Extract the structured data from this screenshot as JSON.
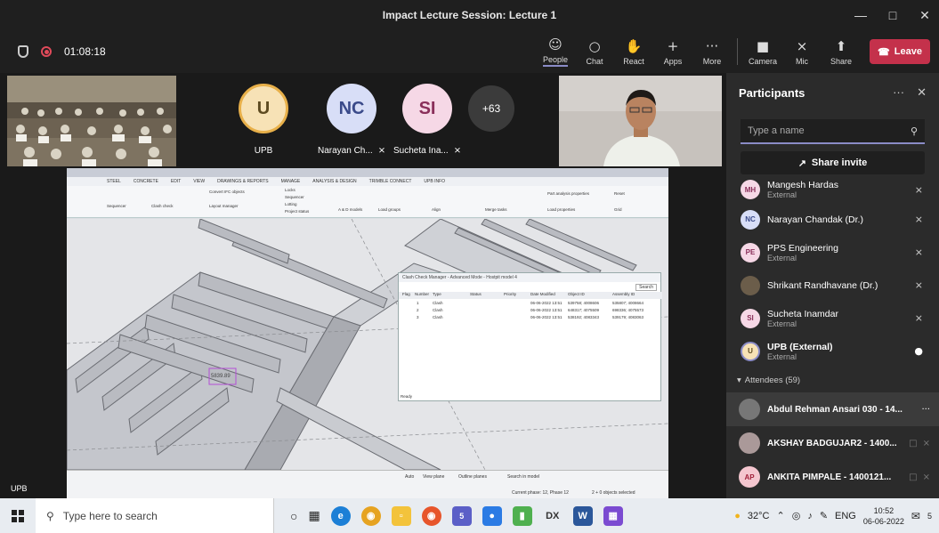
{
  "window": {
    "title": "Impact Lecture Session: Lecture 1"
  },
  "toolbar": {
    "timer": "01:08:18",
    "buttons": [
      {
        "label": "People",
        "icon": "people-icon"
      },
      {
        "label": "Chat",
        "icon": "chat-icon"
      },
      {
        "label": "React",
        "icon": "react-icon"
      },
      {
        "label": "Apps",
        "icon": "apps-icon"
      },
      {
        "label": "More",
        "icon": "more-icon"
      },
      {
        "label": "Camera",
        "icon": "camera-icon"
      },
      {
        "label": "Mic",
        "icon": "mic-off-icon"
      },
      {
        "label": "Share",
        "icon": "share-icon"
      }
    ],
    "leave_label": "Leave"
  },
  "stage": {
    "tiles": [
      {
        "initials": "U",
        "name": "UPB",
        "bg": "#f7e2b6",
        "fg": "#5d4a20"
      },
      {
        "initials": "NC",
        "name": "Narayan Ch...",
        "bg": "#d8def7",
        "fg": "#3a4a8a"
      },
      {
        "initials": "SI",
        "name": "Sucheta Ina...",
        "bg": "#f6d8e6",
        "fg": "#8a2f5a"
      }
    ],
    "overflow_count": "+63",
    "bottom_label": "UPB"
  },
  "shared_screen": {
    "tabs": [
      "STEEL",
      "CONCRETE",
      "EDIT",
      "VIEW",
      "DRAWINGS & REPORTS",
      "MANAGE",
      "ANALYSIS & DESIGN",
      "TRIMBLE CONNECT",
      "UPB INFO"
    ],
    "ribbon_items": [
      "Sequencer",
      "Clash check",
      "Convert IFC objects",
      "Layout manager",
      "Locks",
      "Sequencer",
      "Lotting",
      "Project status",
      "A & D models",
      "Load groups",
      "Align",
      "Merge tasks",
      "Part analysis properties",
      "Load properties",
      "Reset",
      "Grid"
    ],
    "dialog": {
      "title": "Clash Check Manager - Advanced Mode - Hostpit model 4",
      "search_btn": "Search",
      "columns": [
        "Flag",
        "Number",
        "Type",
        "Status",
        "Priority",
        "Date Modified",
        "Object ID",
        "Assembly ID"
      ],
      "rows": [
        [
          "1",
          "Clash",
          "06-06-2022 13:51",
          "539758; 4008606",
          "535807; 4008664"
        ],
        [
          "2",
          "Clash",
          "06-06-2022 13:51",
          "648317; 4075509",
          "698336; 4075573"
        ],
        [
          "3",
          "Clash",
          "06-06-2022 13:51",
          "538192; 4083343",
          "539179; 4083063"
        ]
      ],
      "status": "Ready"
    },
    "coords_label": "5839.89",
    "bottom_items": [
      "Auto",
      "View plane",
      "Outline planes",
      "Search in model",
      "Current phase: 12, Phase 12",
      "2 + 0 objects selected"
    ]
  },
  "panel": {
    "title": "Participants",
    "search_placeholder": "Type a name",
    "share_invite": "Share invite",
    "participants": [
      {
        "initials": "MH",
        "name": "Mangesh Hardas",
        "sub": "External",
        "bg": "#f6d8e6",
        "fg": "#8a2f5a",
        "icon": "mic-off-icon"
      },
      {
        "initials": "NC",
        "name": "Narayan Chandak (Dr.)",
        "sub": "",
        "bg": "#d8def7",
        "fg": "#3a4a8a",
        "icon": "mic-off-icon"
      },
      {
        "initials": "PE",
        "name": "PPS Engineering",
        "sub": "External",
        "bg": "#f6d8e6",
        "fg": "#8a2f5a",
        "icon": "mic-off-icon"
      },
      {
        "initials": "",
        "name": "Shrikant Randhavane (Dr.)",
        "sub": "",
        "bg": "#6b5d4a",
        "fg": "#fff",
        "icon": "mic-off-icon"
      },
      {
        "initials": "SI",
        "name": "Sucheta Inamdar",
        "sub": "External",
        "bg": "#f6d8e6",
        "fg": "#8a2f5a",
        "icon": "mic-off-icon"
      },
      {
        "initials": "U",
        "name": "UPB (External)",
        "sub": "External",
        "bg": "#f7e2b6",
        "fg": "#5d4a20",
        "icon": "mic-on-icon"
      }
    ],
    "attendees_header": "Attendees (59)",
    "attendees": [
      {
        "initials": "",
        "name": "Abdul Rehman Ansari 030 - 14...",
        "bg": "#777",
        "fg": "#fff"
      },
      {
        "initials": "",
        "name": "AKSHAY BADGUJAR2 - 1400...",
        "bg": "#a99",
        "fg": "#fff"
      },
      {
        "initials": "AP",
        "name": "ANKITA PIMPALE - 1400121...",
        "bg": "#f4c6cf",
        "fg": "#a0203a"
      }
    ]
  },
  "taskbar": {
    "search_placeholder": "Type here to search",
    "weather": "32°C",
    "lang": "ENG",
    "time": "10:52",
    "date": "06-06-2022",
    "badge_teams": "5",
    "badge_notif": "5"
  }
}
